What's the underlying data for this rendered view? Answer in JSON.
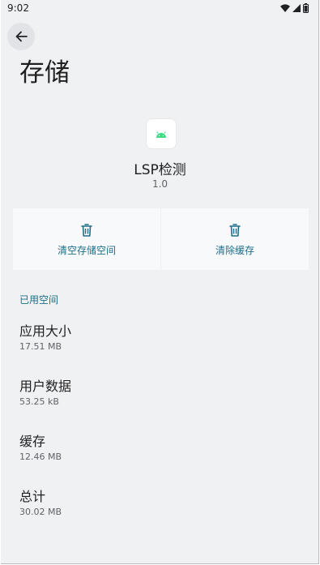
{
  "status_bar": {
    "time": "9:02"
  },
  "header": {
    "title": "存储"
  },
  "app": {
    "name": "LSP检测",
    "version": "1.0"
  },
  "actions": {
    "clear_storage": "清空存储空间",
    "clear_cache": "清除缓存"
  },
  "section": {
    "label": "已用空间"
  },
  "rows": [
    {
      "title": "应用大小",
      "value": "17.51 MB"
    },
    {
      "title": "用户数据",
      "value": "53.25 kB"
    },
    {
      "title": "缓存",
      "value": "12.46 MB"
    },
    {
      "title": "总计",
      "value": "30.02 MB"
    }
  ],
  "colors": {
    "background": "#f0f1f3",
    "accent": "#1d6e89",
    "android_green": "#3ddc84"
  },
  "icons": [
    "back-arrow-icon",
    "wifi-icon",
    "signal-icon",
    "battery-icon",
    "android-icon",
    "trash-icon"
  ]
}
